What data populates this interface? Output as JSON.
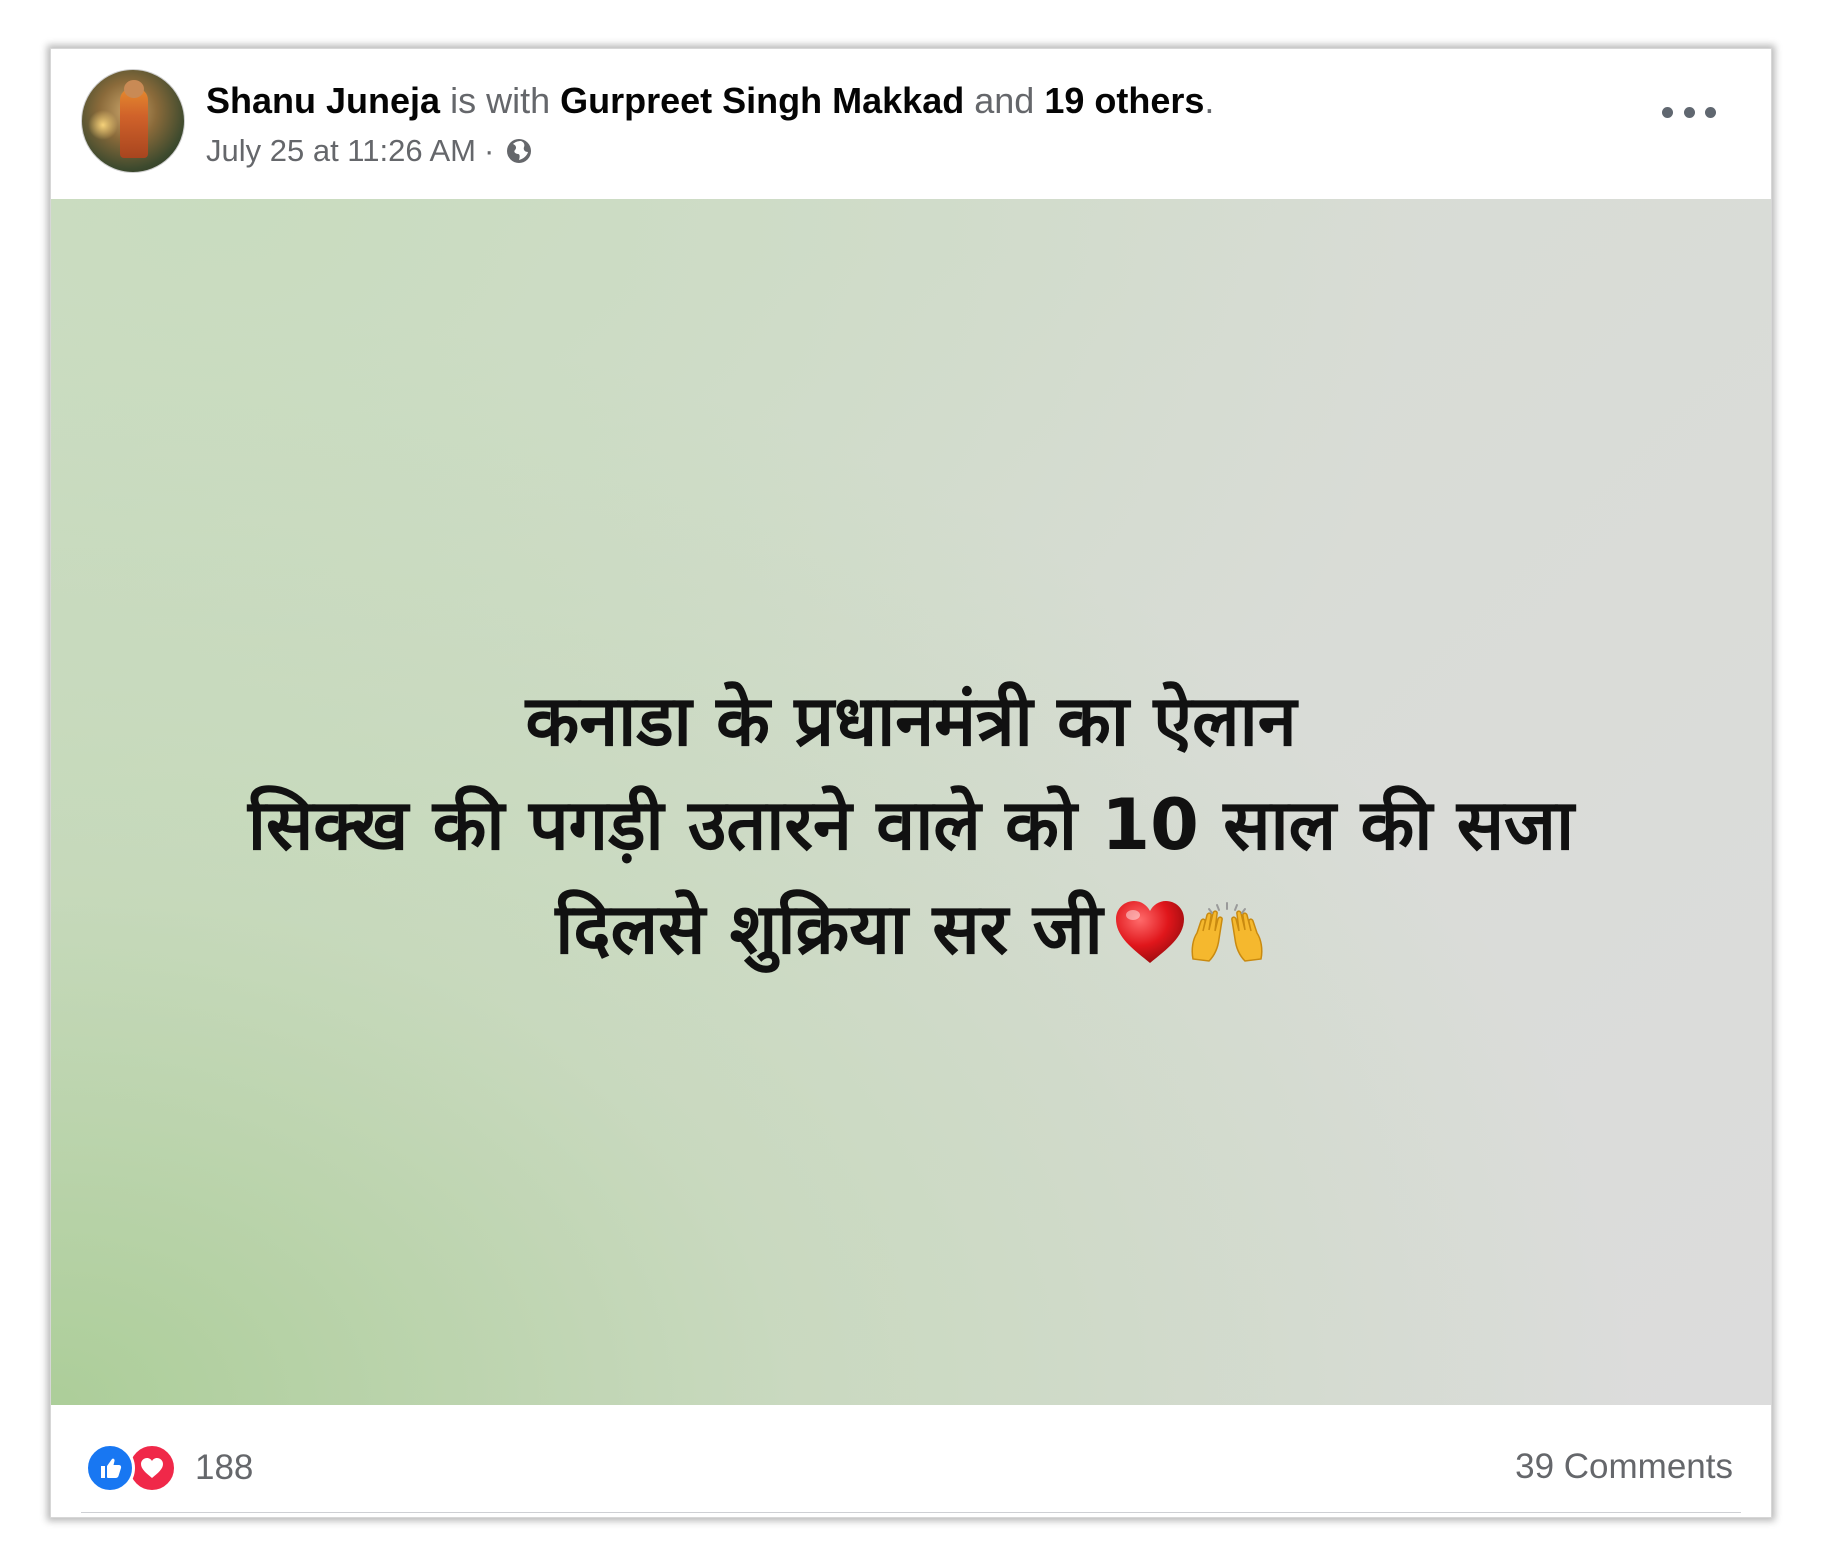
{
  "post": {
    "author_name": "Shanu Juneja",
    "with_text": "is with",
    "tagged_name": "Gurpreet Singh Makkad",
    "and_text": "and",
    "others_text": "19 others",
    "period": ".",
    "timestamp": "July 25 at 11:26 AM",
    "separator": "·",
    "privacy_icon": "globe-icon",
    "more_icon": "more-options-icon"
  },
  "media": {
    "lines": [
      "कनाडा के प्रधानमंत्री का ऐलान",
      "सिक्ख की पगड़ी उतारने वाले को 10 साल की सजा",
      "दिलसे शुक्रिया सर जी"
    ],
    "emojis": [
      "heart-emoji",
      "raising-hands-emoji"
    ],
    "background_colors": [
      "#cfdcc8",
      "#dcdcdc",
      "#aacd96"
    ]
  },
  "footer": {
    "reaction_icons": [
      "like-reaction-icon",
      "love-reaction-icon"
    ],
    "reaction_count": "188",
    "comments_label": "39 Comments"
  },
  "colors": {
    "primary_text": "#050505",
    "secondary_text": "#65676b",
    "like_blue": "#1877f2",
    "love_red": "#f02849"
  }
}
